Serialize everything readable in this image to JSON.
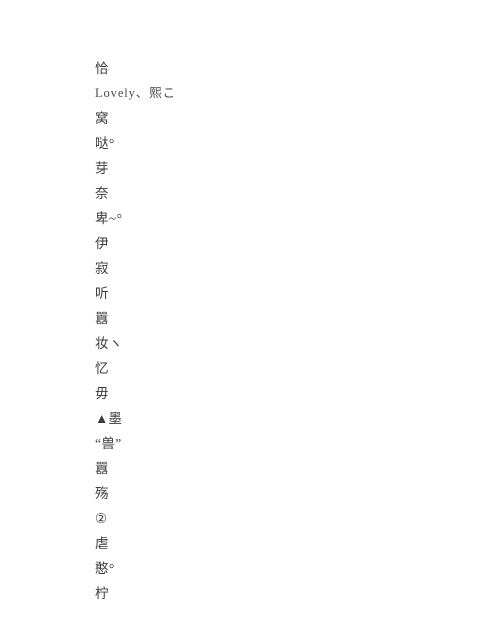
{
  "document": {
    "background_color": "#ffffff",
    "text_color": "#3b3b3b",
    "lines": [
      {
        "id": "line-1",
        "text": "恰"
      },
      {
        "id": "line-2",
        "text": "Lovely、熙こ"
      },
      {
        "id": "line-3",
        "text": "窝"
      },
      {
        "id": "line-4",
        "text": "哒°"
      },
      {
        "id": "line-5",
        "text": "芽"
      },
      {
        "id": "line-6",
        "text": "奈"
      },
      {
        "id": "line-7",
        "text": "卑~°"
      },
      {
        "id": "line-8",
        "text": "伊"
      },
      {
        "id": "line-9",
        "text": "寂"
      },
      {
        "id": "line-10",
        "text": "听"
      },
      {
        "id": "line-11",
        "text": "囂"
      },
      {
        "id": "line-12",
        "text": "妆ヽ"
      },
      {
        "id": "line-13",
        "text": "忆"
      },
      {
        "id": "line-14",
        "text": "毋"
      },
      {
        "id": "line-15",
        "text": "▲墨"
      },
      {
        "id": "line-16",
        "text": "“兽”"
      },
      {
        "id": "line-17",
        "text": "囂"
      },
      {
        "id": "line-18",
        "text": "殇"
      },
      {
        "id": "line-19",
        "text": "②"
      },
      {
        "id": "line-20",
        "text": "虐"
      },
      {
        "id": "line-21",
        "text": "憨°"
      },
      {
        "id": "line-22",
        "text": "柠"
      }
    ]
  }
}
